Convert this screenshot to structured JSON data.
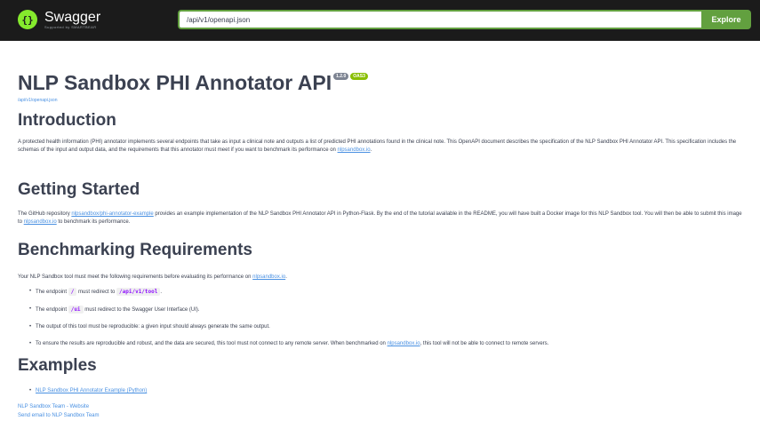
{
  "topbar": {
    "logo_name": "Swagger",
    "logo_sub": "Supported by SMARTBEAR",
    "url_value": "/api/v1/openapi.json",
    "explore_label": "Explore"
  },
  "info": {
    "title": "NLP Sandbox PHI Annotator API",
    "version": "1.2.0",
    "oas": "OAS3",
    "spec_url": "/api/v1/openapi.json"
  },
  "introduction": {
    "heading": "Introduction",
    "text": "A protected health information (PHI) annotator implements several endpoints that take as input a clinical note and outputs a list of predicted PHI annotations found in the clinical note. This OpenAPI document describes the specification of the NLP Sandbox PHI Annotator API. This specification includes the schemas of the input and output data, and the requirements that this annotator must meet if you want to benchmark its performance on ",
    "link": "nlpsandbox.io",
    "end": "."
  },
  "getting_started": {
    "heading": "Getting Started",
    "t1": "The GitHub repository ",
    "repo_link": "nlpsandbox/phi-annotator-example",
    "t2": " provides an example implementation of the NLP Sandbox PHI Annotator API in Python-Flask. By the end of the tutorial available in the README, you will have built a Docker image for this NLP Sandbox tool. You will then be able to submit this image to ",
    "link": "nlpsandbox.io",
    "t3": " to benchmark its performance."
  },
  "benchmarking": {
    "heading": "Benchmarking Requirements",
    "intro": "Your NLP Sandbox tool must meet the following requirements before evaluating its performance on ",
    "intro_link": "nlpsandbox.io",
    "intro_end": ".",
    "r1_a": "The endpoint ",
    "r1_code1": "/",
    "r1_b": " must redirect to ",
    "r1_code2": "/api/v1/tool",
    "r1_c": ".",
    "r2_a": "The endpoint ",
    "r2_code": "/ui",
    "r2_b": " must redirect to the Swagger User Interface (UI).",
    "r3": "The output of this tool must be reproducible: a given input should always generate the same output.",
    "r4_a": "To ensure the results are reproducible and robust, and the data are secured, this tool must not connect to any remote server. When benchmarked on ",
    "r4_link": "nlpsandbox.io",
    "r4_b": ", this tool will not be able to connect to remote servers."
  },
  "examples": {
    "heading": "Examples",
    "item": "NLP Sandbox PHI Annotator Example (Python)"
  },
  "footer": {
    "website": "NLP Sandbox Team - Website",
    "email": "Send email to NLP Sandbox Team"
  }
}
